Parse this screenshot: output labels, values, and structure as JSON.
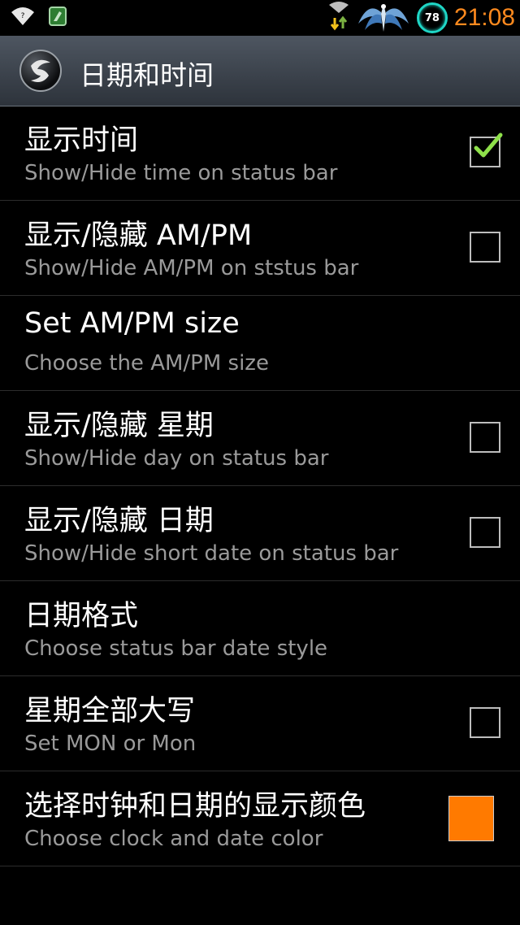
{
  "status_bar": {
    "time": "21:08",
    "battery_level": "78",
    "icons": [
      "wifi-icon",
      "app-notification-icon",
      "data-transfer-icon",
      "phoenix-theme-icon",
      "battery-ring-icon"
    ]
  },
  "action_bar": {
    "title": "日期和时间",
    "icon": "app-logo-icon"
  },
  "settings": [
    {
      "title": "显示时间",
      "subtitle": "Show/Hide time on status bar",
      "widget": "checkbox",
      "checked": true
    },
    {
      "title": "显示/隐藏 AM/PM",
      "subtitle": "Show/Hide AM/PM on ststus bar",
      "widget": "checkbox",
      "checked": false
    },
    {
      "title": "Set AM/PM size",
      "subtitle": "Choose the AM/PM size",
      "widget": "none"
    },
    {
      "title": "显示/隐藏 星期",
      "subtitle": "Show/Hide day on status bar",
      "widget": "checkbox",
      "checked": false
    },
    {
      "title": "显示/隐藏 日期",
      "subtitle": "Show/Hide short date on status bar",
      "widget": "checkbox",
      "checked": false
    },
    {
      "title": "日期格式",
      "subtitle": "Choose status bar date style",
      "widget": "none"
    },
    {
      "title": "星期全部大写",
      "subtitle": "Set MON or Mon",
      "widget": "checkbox",
      "checked": false
    },
    {
      "title": "选择时钟和日期的显示颜色",
      "subtitle": "Choose clock and date color",
      "widget": "color",
      "color": "#ff7a00"
    }
  ],
  "colors": {
    "clock": "#ff8a1e",
    "check": "#8ee04a",
    "battery_ring": "#1fd6c6"
  }
}
